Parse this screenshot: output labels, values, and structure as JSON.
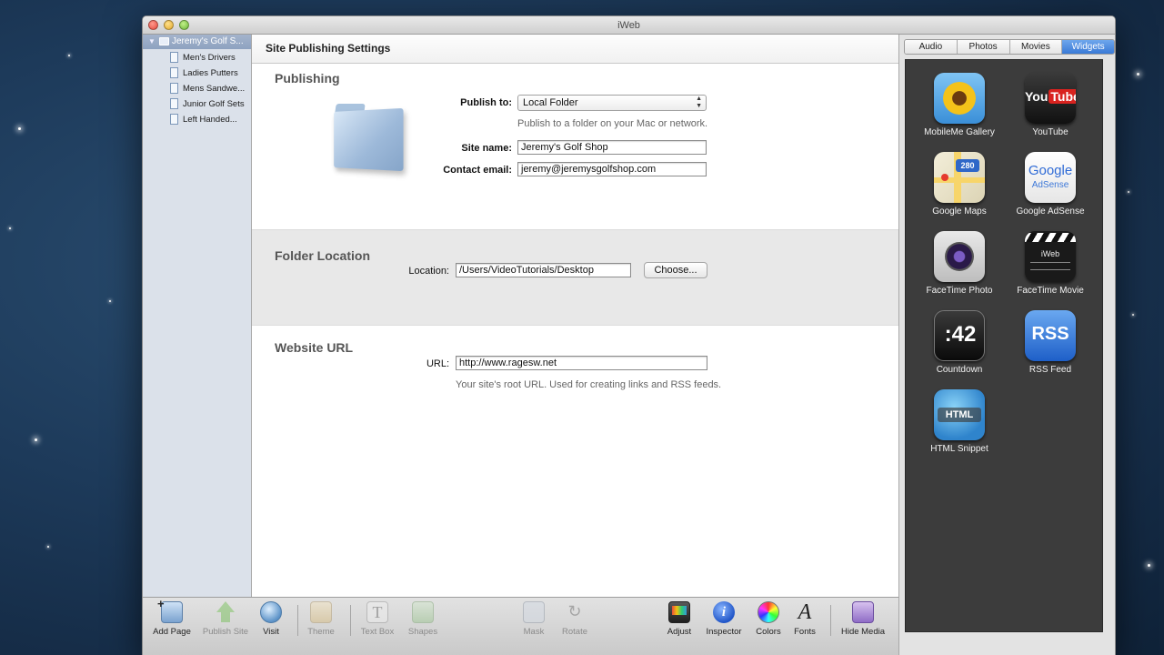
{
  "window": {
    "title": "iWeb"
  },
  "sidebar": {
    "site": "Jeremy's Golf S...",
    "pages": [
      "Men's Drivers",
      "Ladies Putters",
      "Mens Sandwe...",
      "Junior Golf Sets",
      "Left Handed..."
    ]
  },
  "main": {
    "header": "Site Publishing Settings",
    "publishing": {
      "title": "Publishing",
      "publish_to_label": "Publish to:",
      "publish_to_value": "Local Folder",
      "publish_to_hint": "Publish to a folder on your Mac or network.",
      "site_name_label": "Site name:",
      "site_name_value": "Jeremy's Golf Shop",
      "contact_label": "Contact email:",
      "contact_value": "jeremy@jeremysgolfshop.com"
    },
    "folder": {
      "title": "Folder Location",
      "location_label": "Location:",
      "location_value": "/Users/VideoTutorials/Desktop",
      "choose_button": "Choose..."
    },
    "website": {
      "title": "Website URL",
      "url_label": "URL:",
      "url_value": "http://www.ragesw.net",
      "url_hint": "Your site's root URL. Used for creating links and RSS feeds."
    }
  },
  "media": {
    "tabs": [
      "Audio",
      "Photos",
      "Movies",
      "Widgets"
    ],
    "active_tab": "Widgets",
    "widgets": [
      {
        "label": "MobileMe Gallery",
        "icon": "sunflower-icon"
      },
      {
        "label": "YouTube",
        "icon": "youtube-icon",
        "text": "You Tube"
      },
      {
        "label": "Google Maps",
        "icon": "map-icon",
        "text": "280"
      },
      {
        "label": "Google AdSense",
        "icon": "adsense-icon",
        "text": "Google",
        "sub": "AdSense"
      },
      {
        "label": "FaceTime Photo",
        "icon": "camera-icon"
      },
      {
        "label": "FaceTime Movie",
        "icon": "clapper-icon",
        "text": "iWeb"
      },
      {
        "label": "Countdown",
        "icon": "countdown-icon",
        "text": ":42"
      },
      {
        "label": "RSS Feed",
        "icon": "rss-icon",
        "text": "RSS"
      },
      {
        "label": "HTML Snippet",
        "icon": "html-icon",
        "text": "HTML"
      }
    ]
  },
  "toolbar": {
    "items": [
      {
        "label": "Add Page",
        "icon": "add-page-icon",
        "enabled": true
      },
      {
        "label": "Publish Site",
        "icon": "publish-icon",
        "enabled": false
      },
      {
        "label": "Visit",
        "icon": "visit-icon",
        "enabled": true
      },
      {
        "label": "Theme",
        "icon": "theme-icon",
        "enabled": false
      },
      {
        "label": "Text Box",
        "icon": "text-box-icon",
        "enabled": false
      },
      {
        "label": "Shapes",
        "icon": "shapes-icon",
        "enabled": false
      },
      {
        "label": "Mask",
        "icon": "mask-icon",
        "enabled": false
      },
      {
        "label": "Rotate",
        "icon": "rotate-icon",
        "enabled": false
      },
      {
        "label": "Adjust",
        "icon": "adjust-icon",
        "enabled": true
      },
      {
        "label": "Inspector",
        "icon": "inspector-icon",
        "enabled": true
      },
      {
        "label": "Colors",
        "icon": "colors-icon",
        "enabled": true
      },
      {
        "label": "Fonts",
        "icon": "fonts-icon",
        "enabled": true
      },
      {
        "label": "Hide Media",
        "icon": "media-icon",
        "enabled": true
      }
    ]
  }
}
